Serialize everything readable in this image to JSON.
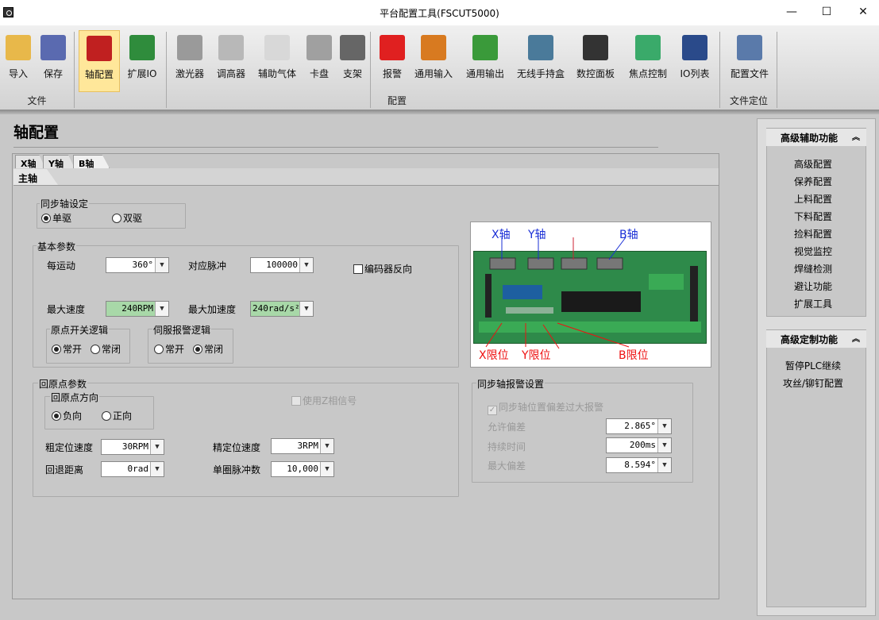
{
  "window": {
    "title": "平台配置工具(FSCUT5000)",
    "minimize": "—",
    "maximize": "☐",
    "close": "✕"
  },
  "ribbon": {
    "buttons": [
      {
        "label": "导入",
        "icon": "folder-open-icon",
        "color": "#e8b84a"
      },
      {
        "label": "保存",
        "icon": "save-disk-icon",
        "color": "#5a6ab0"
      },
      {
        "label": "轴配置",
        "icon": "axis-motor-icon",
        "color": "#c02020"
      },
      {
        "label": "扩展IO",
        "icon": "io-board-icon",
        "color": "#2f8c3c"
      },
      {
        "label": "激光器",
        "icon": "laser-icon",
        "color": "#9a9a9a"
      },
      {
        "label": "调高器",
        "icon": "height-controller-icon",
        "color": "#b8b8b8"
      },
      {
        "label": "辅助气体",
        "icon": "gas-gauge-icon",
        "color": "#d8d8d8"
      },
      {
        "label": "卡盘",
        "icon": "chuck-icon",
        "color": "#a0a0a0"
      },
      {
        "label": "支架",
        "icon": "support-icon",
        "color": "#666666"
      },
      {
        "label": "报警",
        "icon": "alarm-light-icon",
        "color": "#e02020"
      },
      {
        "label": "通用输入",
        "icon": "input-icon",
        "color": "#d87a20"
      },
      {
        "label": "通用输出",
        "icon": "output-icon",
        "color": "#3a9a3a"
      },
      {
        "label": "无线手持盒",
        "icon": "handheld-icon",
        "color": "#4a7a9a"
      },
      {
        "label": "数控面板",
        "icon": "cnc-panel-icon",
        "color": "#333333"
      },
      {
        "label": "焦点控制",
        "icon": "focus-icon",
        "color": "#3aaa6a"
      },
      {
        "label": "IO列表",
        "icon": "io-list-icon",
        "color": "#2a4a8a"
      },
      {
        "label": "配置文件",
        "icon": "config-file-icon",
        "color": "#5a7aaa"
      }
    ],
    "groups": {
      "file": "文件",
      "config": "配置",
      "locate": "文件定位"
    }
  },
  "page": {
    "title": "轴配置",
    "tabs": [
      "X轴",
      "Y轴",
      "B轴"
    ],
    "subtab": "主轴",
    "sync": {
      "legend": "同步轴设定",
      "single": "单驱",
      "dual": "双驱"
    },
    "basic": {
      "legend": "基本参数",
      "per_motion_label": "每运动",
      "per_motion": "360°",
      "pulse_label": "对应脉冲",
      "pulse": "100000",
      "encoder_reverse": "编码器反向",
      "max_speed_label": "最大速度",
      "max_speed": "240RPM",
      "max_accel_label": "最大加速度",
      "max_accel": "240rad/s²",
      "home_logic": {
        "legend": "原点开关逻辑",
        "no": "常开",
        "nc": "常闭"
      },
      "servo_logic": {
        "legend": "伺服报警逻辑",
        "no": "常开",
        "nc": "常闭"
      }
    },
    "homing": {
      "legend": "回原点参数",
      "direction": {
        "legend": "回原点方向",
        "neg": "负向",
        "pos": "正向"
      },
      "use_z": "使用Z相信号",
      "coarse_label": "粗定位速度",
      "coarse": "30RPM",
      "fine_label": "精定位速度",
      "fine": "3RPM",
      "back_label": "回退距离",
      "back": "0rad",
      "pulses_label": "单圈脉冲数",
      "pulses": "10,000"
    },
    "board": {
      "x_axis": "X轴",
      "y_axis": "Y轴",
      "b_axis": "B轴",
      "x_limit": "X限位",
      "y_limit": "Y限位",
      "b_limit": "B限位"
    },
    "sync_alarm": {
      "legend": "同步轴报警设置",
      "enable": "同步轴位置偏差过大报警",
      "allow_label": "允许偏差",
      "allow": "2.865°",
      "duration_label": "持续时间",
      "duration": "200ms",
      "max_label": "最大偏差",
      "max": "8.594°"
    }
  },
  "sidebar": {
    "adv_aux": {
      "title": "高级辅助功能",
      "items": [
        "高级配置",
        "保养配置",
        "上料配置",
        "下料配置",
        "捡料配置",
        "视觉监控",
        "焊缝检测",
        "避让功能",
        "扩展工具"
      ]
    },
    "adv_custom": {
      "title": "高级定制功能",
      "items": [
        "暂停PLC继续",
        "攻丝/铆钉配置"
      ]
    }
  }
}
